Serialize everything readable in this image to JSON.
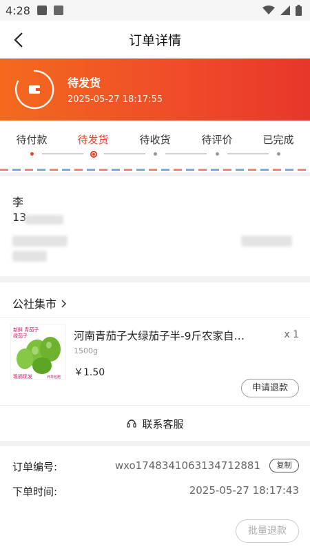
{
  "status_bar": {
    "time": "4:28"
  },
  "nav": {
    "title": "订单详情"
  },
  "banner": {
    "status": "待发货",
    "time": "2025-05-27 18:17:55"
  },
  "steps": [
    "待付款",
    "待发货",
    "待收货",
    "待评价",
    "已完成"
  ],
  "address": {
    "name": "李",
    "phone": "13"
  },
  "shop": {
    "name": "公社集市"
  },
  "product": {
    "name": "河南青茄子大绿茄子半-9斤农家自…",
    "qty": "x 1",
    "spec": "1500g",
    "price": "￥1.50",
    "refund_label": "申请退款",
    "image_text": [
      "新鲜 青茄子",
      "绿茄子",
      "现摘现发",
      "坏单包赔"
    ]
  },
  "service": {
    "label": "联系客服"
  },
  "order": {
    "number_label": "订单编号:",
    "number": "wxo1748341063134712881",
    "copy_label": "复制",
    "time_label": "下单时间:",
    "time": "2025-05-27 18:17:43"
  },
  "bulk_refund_label": "批量退款",
  "colors": {
    "accent": "#e8432b",
    "banner_start": "#f36a1d",
    "banner_end": "#e8362a"
  }
}
